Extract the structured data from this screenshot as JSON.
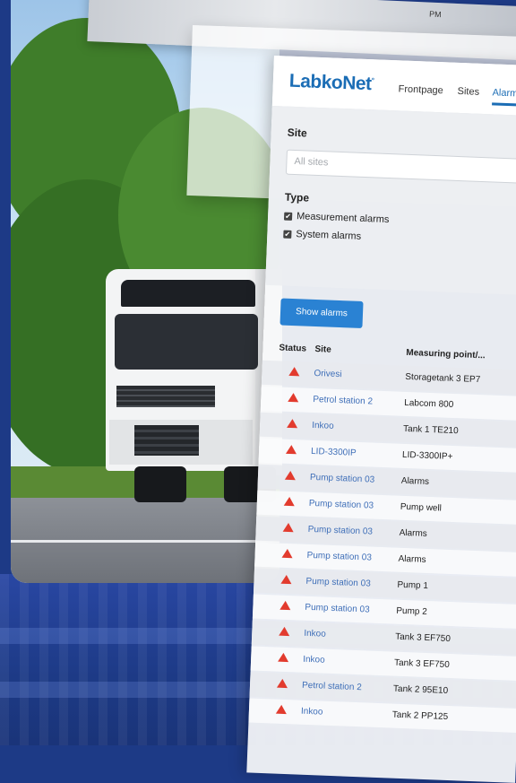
{
  "top_window": {
    "status_text": "PM"
  },
  "app": {
    "logo": "LabkoNet",
    "nav": [
      {
        "label": "Frontpage"
      },
      {
        "label": "Sites"
      },
      {
        "label": "Alarms"
      }
    ],
    "filters": {
      "site_label": "Site",
      "site_placeholder": "All sites",
      "type_label": "Type",
      "types": [
        {
          "label": "Measurement alarms",
          "checked": true
        },
        {
          "label": "System alarms",
          "checked": true
        }
      ]
    },
    "show_button": "Show alarms",
    "table": {
      "headers": [
        "Status",
        "Site",
        "Measuring point/..."
      ],
      "rows": [
        {
          "site": "Orivesi",
          "point": "Storagetank 3 EP7"
        },
        {
          "site": "Petrol station 2",
          "point": "Labcom 800"
        },
        {
          "site": "Inkoo",
          "point": "Tank 1 TE210"
        },
        {
          "site": "LID-3300IP",
          "point": "LID-3300IP+"
        },
        {
          "site": "Pump station 03",
          "point": "Alarms"
        },
        {
          "site": "Pump station 03",
          "point": "Pump well"
        },
        {
          "site": "Pump station 03",
          "point": "Alarms"
        },
        {
          "site": "Pump station 03",
          "point": "Alarms"
        },
        {
          "site": "Pump station 03",
          "point": "Pump 1"
        },
        {
          "site": "Pump station 03",
          "point": "Pump 2"
        },
        {
          "site": "Inkoo",
          "point": "Tank 3 EF750"
        },
        {
          "site": "Inkoo",
          "point": "Tank 3 EF750"
        },
        {
          "site": "Petrol station 2",
          "point": "Tank 2 95E10"
        },
        {
          "site": "Inkoo",
          "point": "Tank 2 PP125"
        }
      ]
    }
  },
  "colors": {
    "accent": "#1b6db5",
    "button": "#2a82d3",
    "alarm": "#e23b2e",
    "link": "#3f6fb8"
  }
}
